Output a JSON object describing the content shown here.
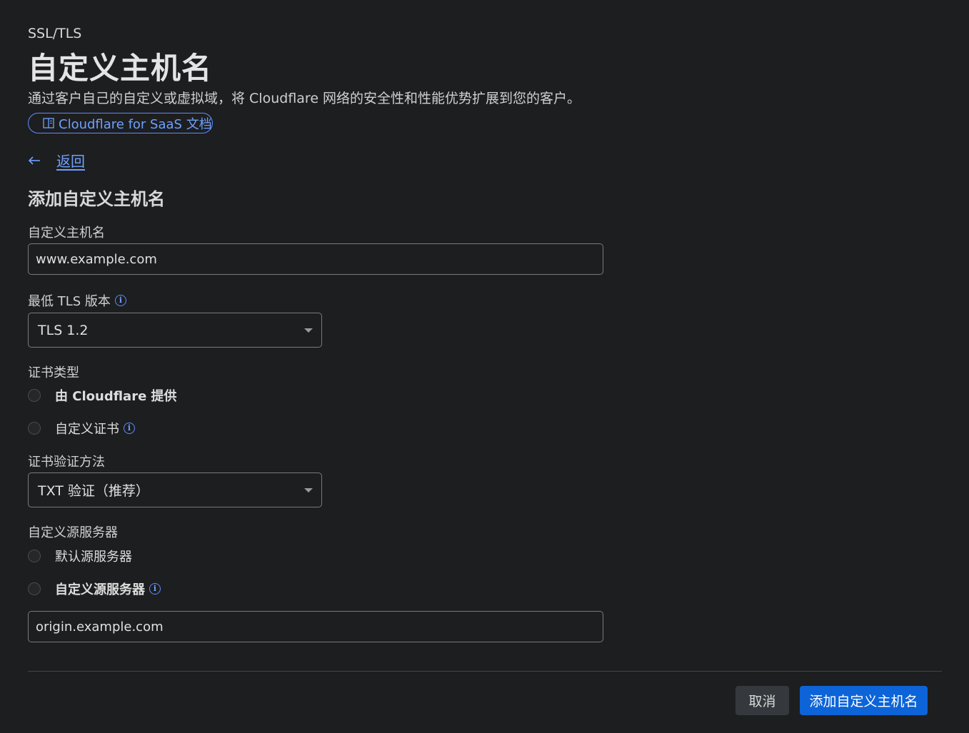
{
  "header": {
    "breadcrumb": "SSL/TLS",
    "title": "自定义主机名",
    "description": "通过客户自己的自定义或虚拟域，将 Cloudflare 网络的安全性和性能优势扩展到您的客户。",
    "docs_link": "Cloudflare for SaaS 文档"
  },
  "back_link": "返回",
  "form": {
    "section_title": "添加自定义主机名",
    "hostname": {
      "label": "自定义主机名",
      "value": "www.example.com"
    },
    "min_tls": {
      "label": "最低 TLS 版本",
      "selected": "TLS 1.2"
    },
    "cert_type": {
      "label": "证书类型",
      "options": [
        "由 Cloudflare 提供",
        "自定义证书"
      ]
    },
    "cert_validation": {
      "label": "证书验证方法",
      "selected": "TXT 验证（推荐）"
    },
    "origin": {
      "label": "自定义源服务器",
      "options": [
        "默认源服务器",
        "自定义源服务器"
      ],
      "value": "origin.example.com"
    }
  },
  "actions": {
    "cancel": "取消",
    "submit": "添加自定义主机名"
  },
  "colors": {
    "background": "#1d1e20",
    "accent": "#6ea1ff",
    "primary_button": "#0d64d8"
  },
  "icons": [
    "book-icon",
    "arrow-left-icon",
    "info-icon",
    "chevron-down-icon"
  ]
}
